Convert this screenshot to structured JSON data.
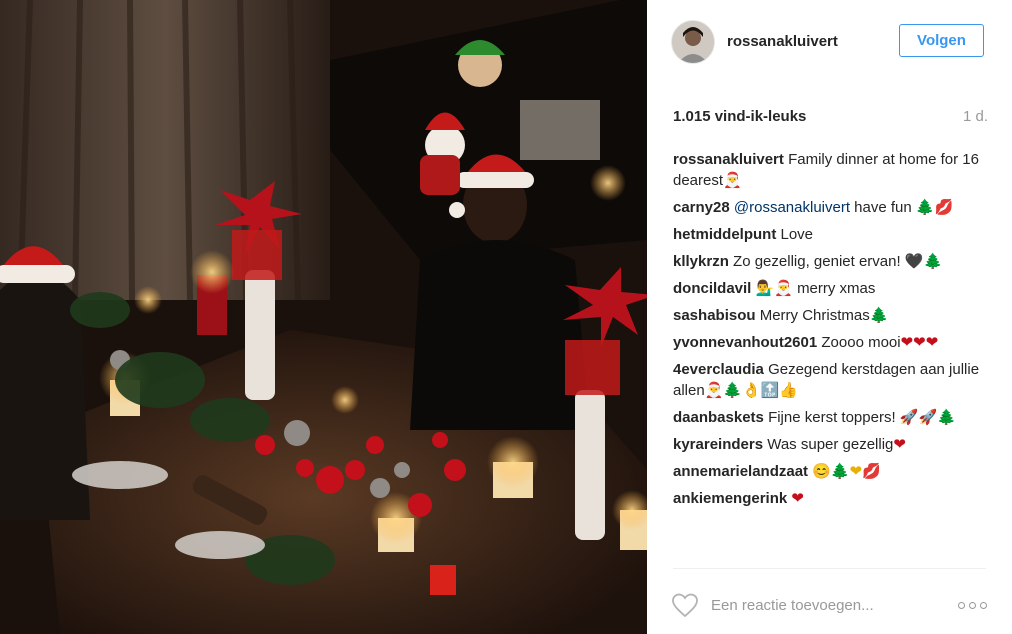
{
  "post": {
    "username": "rossanakluivert",
    "follow_label": "Volgen",
    "likes": "1.015 vind-ik-leuks",
    "time": "1 d."
  },
  "comments": [
    {
      "user": "rossanakluivert",
      "text": "Family dinner at home for 16 dearest",
      "emoji": "🎅"
    },
    {
      "user": "carny28",
      "mention": "@rossanakluivert",
      "text": "have fun",
      "emoji": "🌲💋"
    },
    {
      "user": "hetmiddelpunt",
      "text": "Love",
      "emoji": ""
    },
    {
      "user": "kllykrzn",
      "text": "Zo gezellig, geniet ervan!",
      "emoji": "🖤🌲"
    },
    {
      "user": "doncildavil",
      "text": "merry xmas",
      "emoji": "💁‍♂️🎅"
    },
    {
      "user": "sashabisou",
      "text": "Merry Christmas",
      "emoji": "🌲"
    },
    {
      "user": "yvonnevanhout2601",
      "text": "Zoooo mooi",
      "emoji": "❤❤❤"
    },
    {
      "user": "4everclaudia",
      "text": "Gezegend kerstdagen aan jullie allen",
      "emoji": "🎅🌲👌🔝👍"
    },
    {
      "user": "daanbaskets",
      "text": "Fijne kerst toppers!",
      "emoji": "🚀🚀🌲"
    },
    {
      "user": "kyrareinders",
      "text": "Was super gezellig",
      "emoji": "❤"
    },
    {
      "user": "annemarielandzaat",
      "text": "",
      "emoji": "😊🌲❤💋"
    },
    {
      "user": "ankiemengerink",
      "text": "",
      "emoji": "❤"
    }
  ],
  "comment_box": {
    "placeholder": "Een reactie toevoegen..."
  },
  "icons": {
    "like": "heart-icon",
    "options": "more-options-icon"
  },
  "colors": {
    "accent": "#3897f0",
    "mention": "#003569",
    "muted": "#999999"
  }
}
